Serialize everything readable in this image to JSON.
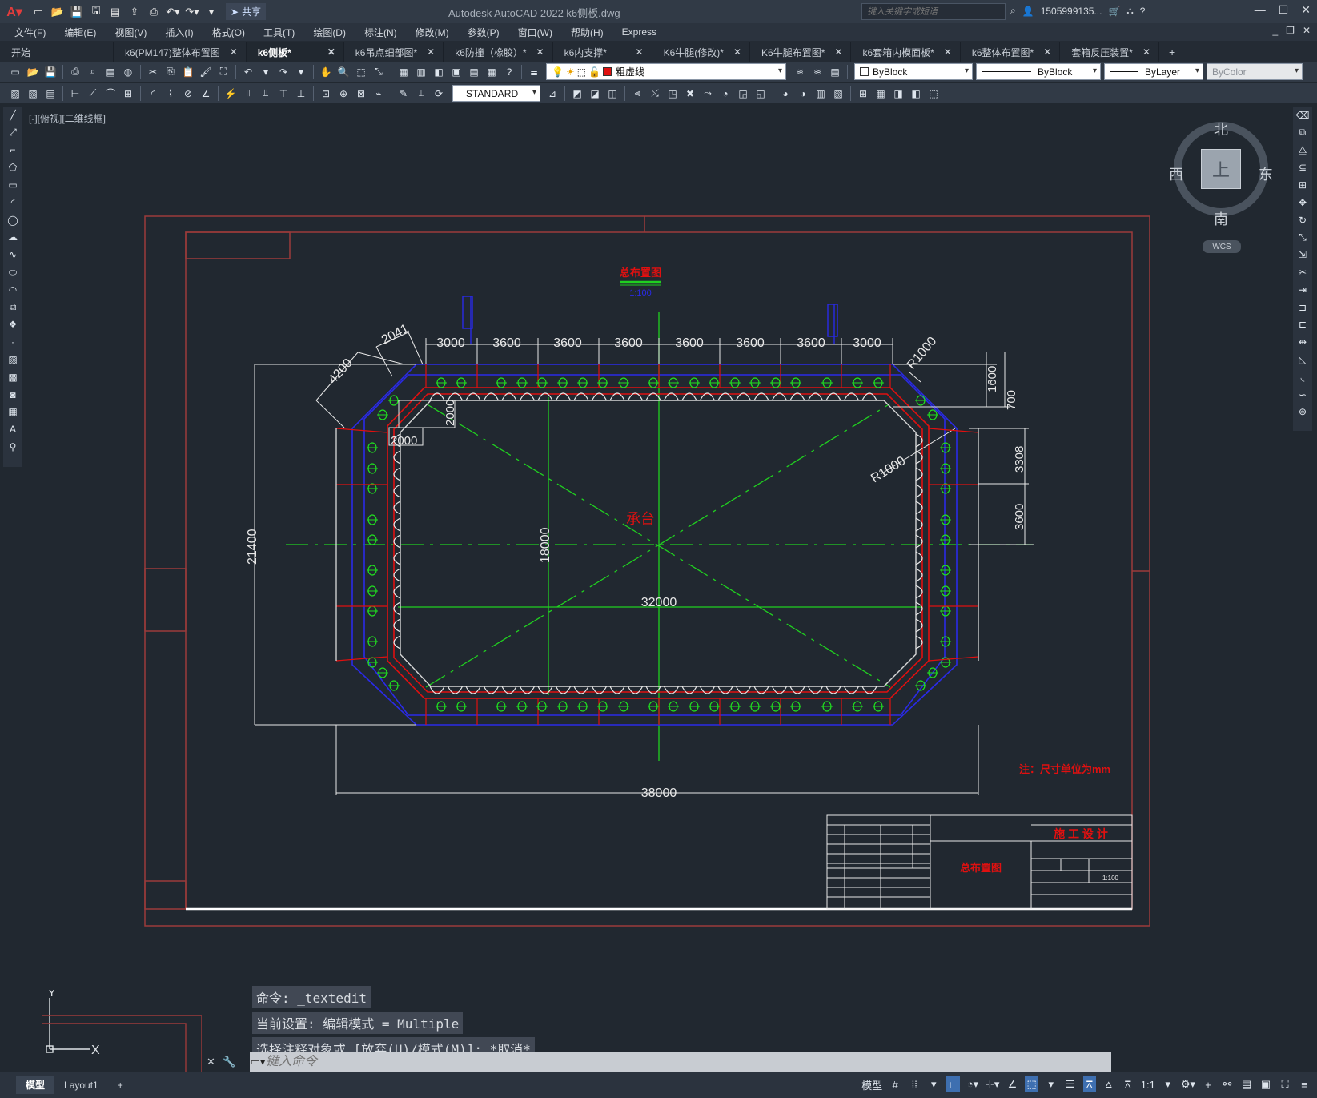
{
  "titlebar": {
    "app_title": "Autodesk AutoCAD 2022    k6侧板.dwg",
    "share_label": "共享",
    "search_placeholder": "键入关键字或短语",
    "user": "1505999135...",
    "qat_icons": [
      "new-icon",
      "open-icon",
      "save-icon",
      "saveas-icon",
      "plot-icon",
      "undo-icon",
      "redo-icon"
    ]
  },
  "menu": [
    "文件(F)",
    "编辑(E)",
    "视图(V)",
    "插入(I)",
    "格式(O)",
    "工具(T)",
    "绘图(D)",
    "标注(N)",
    "修改(M)",
    "参数(P)",
    "窗口(W)",
    "帮助(H)",
    "Express"
  ],
  "tabs": [
    {
      "label": "开始",
      "active": false,
      "closable": false
    },
    {
      "label": "k6(PM147)整体布置图",
      "active": false,
      "closable": true
    },
    {
      "label": "k6侧板*",
      "active": true,
      "closable": true
    },
    {
      "label": "k6吊点细部图*",
      "active": false,
      "closable": true
    },
    {
      "label": "k6防撞（橡胶）*",
      "active": false,
      "closable": true
    },
    {
      "label": "k6内支撑*",
      "active": false,
      "closable": true
    },
    {
      "label": "K6牛腿(修改)*",
      "active": false,
      "closable": true
    },
    {
      "label": "K6牛腿布置图*",
      "active": false,
      "closable": true
    },
    {
      "label": "k6套箱内模面板*",
      "active": false,
      "closable": true
    },
    {
      "label": "k6整体布置图*",
      "active": false,
      "closable": true
    },
    {
      "label": "套箱反压装置*",
      "active": false,
      "closable": true
    }
  ],
  "properties": {
    "layer": "粗虚线",
    "layer_color": "#e01010",
    "color": "ByBlock",
    "linetype": "ByBlock",
    "lineweight": "ByLayer",
    "plotstyle": "ByColor",
    "textstyle": "STANDARD"
  },
  "viewport": {
    "label": "[-][俯视][二维线框]"
  },
  "viewcube": {
    "north": "北",
    "south": "南",
    "east": "东",
    "west": "西",
    "face": "上",
    "wcs": "WCS"
  },
  "drawing": {
    "title": "总布置图",
    "scale": "1:100",
    "center_label": "承台",
    "note": "注：尺寸单位为mm",
    "top_dims": [
      "3000",
      "3600",
      "3600",
      "3600",
      "3600",
      "3600",
      "3600",
      "3000"
    ],
    "dim_2041": "2041",
    "dim_4200": "4200",
    "dim_r1000_top": "R1000",
    "dim_r1000_mid": "R1000",
    "dim_1600": "1600",
    "dim_700": "700",
    "dim_2000_v": "2000",
    "dim_2000_h": "2000",
    "dim_3308": "3308",
    "dim_3600_r": "3600",
    "dim_21400": "21400",
    "dim_18000": "18000",
    "dim_32000": "32000",
    "dim_38000": "38000",
    "titleblock": {
      "design_stage": "施 工 设 计",
      "drawing_name": "总布置图",
      "scale": "1:100"
    }
  },
  "colors": {
    "frame": "#b04040",
    "inner_outline": "#e01010",
    "dim_white": "#e8e8e8",
    "green": "#20e020",
    "blue": "#2020e0",
    "drawing_bg": "#212830"
  },
  "ucs": {
    "x": "X",
    "y": "Y"
  },
  "command": {
    "history": [
      "命令: _textedit",
      "当前设置: 编辑模式 = Multiple",
      "选择注释对象或 [放弃(U)/模式(M)]: *取消*"
    ],
    "placeholder": "键入命令"
  },
  "status": {
    "layout_tabs": [
      "模型",
      "Layout1"
    ],
    "model_label": "模型",
    "scale": "1:1"
  }
}
